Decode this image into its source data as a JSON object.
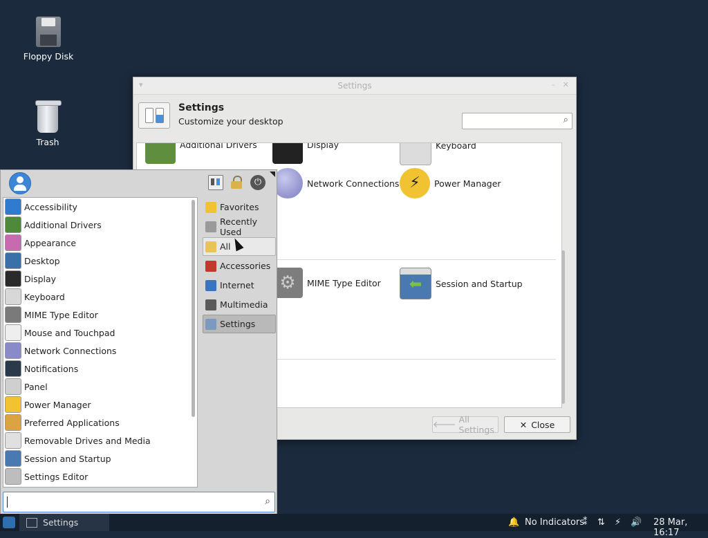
{
  "desktop": {
    "icons": [
      {
        "label": "Floppy Disk",
        "icon": "floppy-disk-icon"
      },
      {
        "label": "Trash",
        "icon": "trash-icon"
      }
    ]
  },
  "settings_window": {
    "title": "Settings",
    "header_title": "Settings",
    "header_subtitle": "Customize your desktop",
    "search_placeholder": "",
    "grid": [
      {
        "label": "Additional Drivers",
        "icon": "additional-drivers-icon"
      },
      {
        "label": "Display",
        "icon": "display-icon"
      },
      {
        "label": "Keyboard",
        "icon": "keyboard-icon"
      },
      {
        "label": "Network Connections",
        "icon": "network-icon"
      },
      {
        "label": "Power Manager",
        "icon": "power-manager-icon"
      },
      {
        "label": "MIME Type Editor",
        "icon": "mime-gear-icon"
      },
      {
        "label": "Session and Startup",
        "icon": "session-startup-icon"
      }
    ],
    "buttons": {
      "all_settings": "All Settings",
      "close": "Close"
    }
  },
  "whisker_menu": {
    "apps": [
      {
        "label": "Accessibility",
        "color": "#2f7bd0"
      },
      {
        "label": "Additional Drivers",
        "color": "#4f8a3a"
      },
      {
        "label": "Appearance",
        "color": "#c76ab0"
      },
      {
        "label": "Desktop",
        "color": "#3a6fa8"
      },
      {
        "label": "Display",
        "color": "#2a2a2a"
      },
      {
        "label": "Keyboard",
        "color": "#d8d8d8"
      },
      {
        "label": "MIME Type Editor",
        "color": "#7a7a7a"
      },
      {
        "label": "Mouse and Touchpad",
        "color": "#eeeeee"
      },
      {
        "label": "Network Connections",
        "color": "#8a8ac8"
      },
      {
        "label": "Notifications",
        "color": "#2a3a4a"
      },
      {
        "label": "Panel",
        "color": "#cfcfcf"
      },
      {
        "label": "Power Manager",
        "color": "#f1c232"
      },
      {
        "label": "Preferred Applications",
        "color": "#d9a441"
      },
      {
        "label": "Removable Drives and Media",
        "color": "#e0e0e0"
      },
      {
        "label": "Session and Startup",
        "color": "#4a78b0"
      },
      {
        "label": "Settings Editor",
        "color": "#bdbdbd"
      }
    ],
    "categories": [
      {
        "label": "Favorites",
        "color": "#f1c232"
      },
      {
        "label": "Recently Used",
        "color": "#9a9a9a"
      },
      {
        "label": "All",
        "color": "#e7c35a"
      },
      {
        "label": "Accessories",
        "color": "#c0392b"
      },
      {
        "label": "Internet",
        "color": "#3a74c0"
      },
      {
        "label": "Multimedia",
        "color": "#5a5a5a"
      },
      {
        "label": "Settings",
        "color": "#7a9ac0"
      }
    ],
    "search_value": ""
  },
  "taskbar": {
    "task_label": "Settings",
    "indicators_label": "No Indicators",
    "clock": "28 Mar, 16:17"
  }
}
